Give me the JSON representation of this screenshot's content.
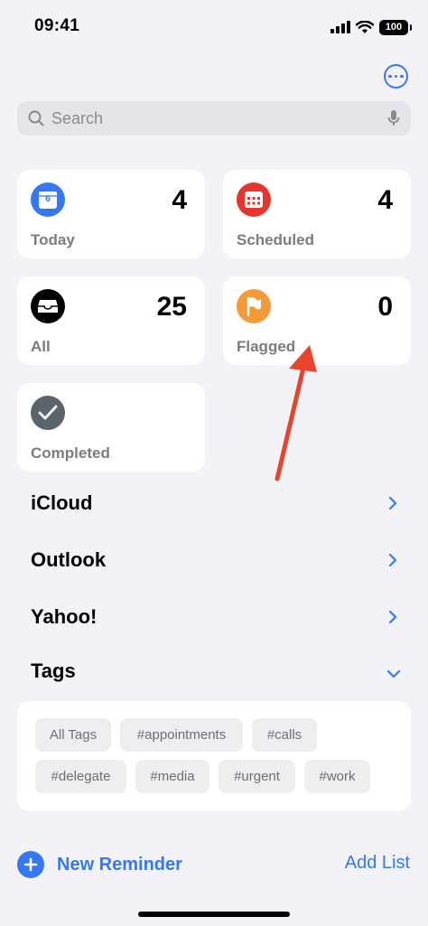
{
  "status": {
    "time": "09:41",
    "battery": "100"
  },
  "search": {
    "placeholder": "Search"
  },
  "smart_lists": [
    {
      "id": "today",
      "label": "Today",
      "count": "4",
      "icon": "calendar-icon",
      "color": "#3478f6",
      "calendar_day": "6"
    },
    {
      "id": "scheduled",
      "label": "Scheduled",
      "count": "4",
      "icon": "calendar-grid-icon",
      "color": "#e5352d"
    },
    {
      "id": "all",
      "label": "All",
      "count": "25",
      "icon": "tray-icon",
      "color": "#000000"
    },
    {
      "id": "flagged",
      "label": "Flagged",
      "count": "0",
      "icon": "flag-icon",
      "color": "#f49a36"
    },
    {
      "id": "completed",
      "label": "Completed",
      "icon": "checkmark-icon",
      "color": "#5b636b"
    }
  ],
  "accounts": [
    {
      "name": "iCloud",
      "icon": "chevron-right-icon"
    },
    {
      "name": "Outlook",
      "icon": "chevron-right-icon"
    },
    {
      "name": "Yahoo!",
      "icon": "chevron-right-icon"
    }
  ],
  "tags": {
    "title": "Tags",
    "icon": "chevron-down-icon",
    "items": [
      "All Tags",
      "#appointments",
      "#calls",
      "#delegate",
      "#media",
      "#urgent",
      "#work"
    ]
  },
  "footer": {
    "new_reminder": "New Reminder",
    "add_list": "Add List"
  },
  "colors": {
    "accent": "#3478f6",
    "annotation_arrow": "#e7432d"
  }
}
